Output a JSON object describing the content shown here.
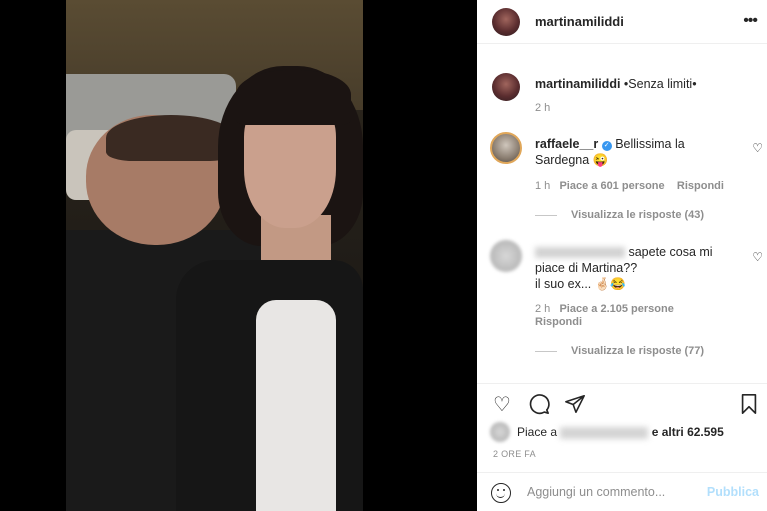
{
  "post": {
    "username": "martinamiliddi",
    "more_icon": "more-horizontal-icon"
  },
  "caption": {
    "username": "martinamiliddi",
    "text": "•Senza limiti•",
    "time": "2 h"
  },
  "comments": [
    {
      "username": "raffaele__r",
      "verified": true,
      "text_line1": "Bellissima la",
      "text_line2": "Sardegna",
      "emoji": "😜",
      "time": "1 h",
      "likes": "Piace a 601 persone",
      "reply": "Rispondi",
      "view_replies": "Visualizza le risposte (43)"
    },
    {
      "username": "",
      "text_line1": "sapete cosa mi",
      "text_line2": "piace di Martina??",
      "text_line3": "il suo ex...",
      "emoji": "🤞🏻😂",
      "time": "2 h",
      "likes": "Piace a 2.105 persone",
      "reply": "Rispondi",
      "view_replies": "Visualizza le risposte (77)"
    }
  ],
  "likes_summary": {
    "prefix": "Piace a",
    "suffix": "e altri 62.595"
  },
  "timestamp": "2 ORE FA",
  "comment_box": {
    "placeholder": "Aggiungi un commento...",
    "publish": "Pubblica"
  }
}
